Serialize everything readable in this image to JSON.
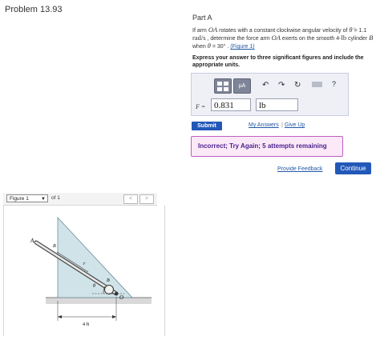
{
  "problem": {
    "title": "Problem 13.93"
  },
  "part": {
    "label": "Part A"
  },
  "question": {
    "t1": "If arm ",
    "oa1": "OA",
    "t2": " rotates with a constant clockwise angular velocity of ",
    "theta_dot": "θ̇",
    "t3": " = 1.1 ",
    "rad_unit": "rad/s",
    "t4": " , determine the force arm ",
    "oa2": "OA",
    "t5": " exerts on the smooth 4-",
    "lb_unit": "lb",
    "t6": " cylinder ",
    "b_label": "B",
    "t7": " when ",
    "theta": "θ",
    "t8": " = 30° .",
    "figure_link": "(Figure 1)"
  },
  "instruction": "Express your answer to three significant figures and include the appropriate units.",
  "answer": {
    "units_button": "μA",
    "undo_icon": "↶",
    "redo_icon": "↷",
    "reset_icon": "↻",
    "help_icon": "?",
    "variable_label": "F =",
    "value": "0.831",
    "unit": "lb"
  },
  "actions": {
    "submit": "Submit",
    "my_answers": "My Answers",
    "separator": "|",
    "give_up": "Give Up"
  },
  "feedback": {
    "message": "Incorrect; Try Again; 5 attempts remaining"
  },
  "footer": {
    "provide_feedback": "Provide Feedback",
    "continue": "Continue"
  },
  "figure": {
    "selector_value": "Figure 1",
    "chevron": "▼",
    "of_text": "of 1",
    "prev": "<",
    "next": ">",
    "labels": {
      "A": "A",
      "B": "B",
      "r": "r",
      "theta": "θ",
      "O": "O",
      "dimension": "4 ft"
    }
  },
  "colors": {
    "link": "#2258a6",
    "primary_button": "#2358b8",
    "feedback_border": "#c05fc0",
    "feedback_bg": "#fbe9f8",
    "feedback_text": "#4a1e8c",
    "wedge_fill": "#cfe3e8"
  }
}
